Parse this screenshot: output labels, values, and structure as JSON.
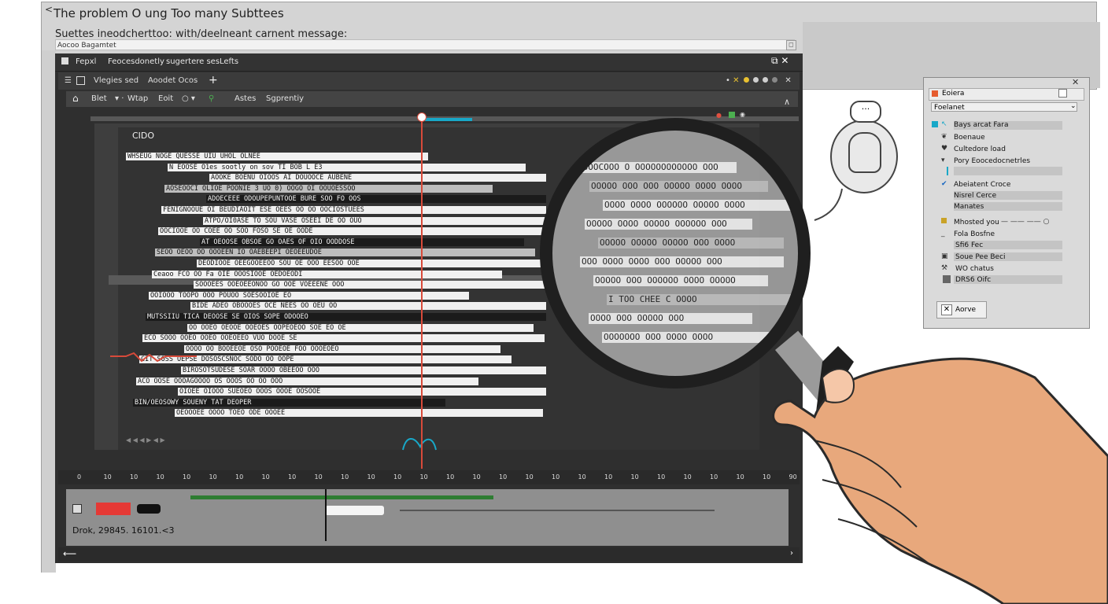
{
  "outer": {
    "back": "<",
    "title": "The problem O ung Too many Subttees",
    "subtitle": "Suettes ineodcherttoo: with/deelneant carnent message:",
    "field_value": "Aocoo Bagamtet"
  },
  "menu": {
    "items": [
      "Fepxl",
      "Feocesdonetly",
      "sugertere ses",
      "Lefts"
    ]
  },
  "tabs": [
    "Vlegies sed",
    "Aoodet Ocos"
  ],
  "toolbar": {
    "items": [
      "Blet",
      "Wtap",
      "Eoit",
      "Astes",
      "Sgprentiy"
    ]
  },
  "canvas": {
    "label": "CIDO"
  },
  "subtitle_lines": [
    {
      "t": "WHSEUG NOGE QUESSE UIU UHOL OLNEE",
      "s": "w"
    },
    {
      "t": "N EOOSE O1es sootly on sov TI BOB L E3",
      "s": "w"
    },
    {
      "t": "AOOKE BOENU OIOOS AI DOUOOCE AUBENE",
      "s": "w"
    },
    {
      "t": "AOSEOOCI OLIOE POONIE 3 UO 0) OOGO OI OOUOESSOO",
      "s": "g"
    },
    {
      "t": "ADOECEEE ODOUPEPUNTOOE BURE SOO FO OOS",
      "s": "b"
    },
    {
      "t": "FENIGNOOUE OI BEUDIAOIT ESE OEES OO OO OOCIOSTUEES",
      "s": "w"
    },
    {
      "t": "ATPO/OI0ASE TO SOU VASE OSEEI DE OO OUO",
      "s": "w"
    },
    {
      "t": "OOCIOOE OO COEE OO SOO FOSO SE OE OODE",
      "s": "w"
    },
    {
      "t": "AT OEOOSE OBSOE GO OAES OF OIO OODDOSE",
      "s": "b"
    },
    {
      "t": "SEOO OEOO OO OOOEEN IO OAEBEEPI OEOEEUDOE",
      "s": "g"
    },
    {
      "t": "DEODIOOE OEEGOOEEOO SOU OE OOO EESOO OOE",
      "s": "w"
    },
    {
      "t": "Ceaoo FCO OO Fa OIE OOOSIOOE OEDOEODI",
      "s": "w"
    },
    {
      "t": "SOOOEES OOEOEEONOO GO OOE VOEEENE OOO",
      "s": "w"
    },
    {
      "t": "OOIOOO TOOPO OOO POUOO SOESOOIOE EO",
      "s": "w"
    },
    {
      "t": "BIDE ADEO OBOOOES OCE NEES OO OEU OO",
      "s": "w"
    },
    {
      "t": "MUTSSIIU TICA DEOOSE SE OIOS SOPE ODOOEO",
      "s": "b"
    },
    {
      "t": "OO OOEO OEOOE OOEOES OOPEOEOO SOE EO OE",
      "s": "w"
    },
    {
      "t": "ECO SOOO OOEO OOEO OOEOEEO VUO DOOE SE",
      "s": "w"
    },
    {
      "t": "OOOO OO BOOEEOE OSO POOEOE FOO OOOEOEO",
      "s": "w"
    },
    {
      "t": "CIT SOSS OEPSE DOSOSCSNOC SODO OO OOPE",
      "s": "w"
    },
    {
      "t": "BIROSOTSUDESE SOAR OOOO OBEEOO OOO",
      "s": "w"
    },
    {
      "t": "ACO OOSE OOOAGOOOO OS OOOS OO OO OOO",
      "s": "w"
    },
    {
      "t": "OIOEE OIOOO SUEOEO OOOS OOOE OOSOOE",
      "s": "w"
    },
    {
      "t": "BIN/OEOSOWY SOUENY TAT DEOPER",
      "s": "b"
    },
    {
      "t": "OEOOOEE OOOO TOEO ODE OOOEE",
      "s": "w"
    }
  ],
  "lens_lines": [
    "OOOOCOOO O OOOOOOOOOOOO OOO",
    "OOOOO OOO OOO OOOOO OOOO OOOO",
    "OOOO OOOO OOOOOO OOOOO OOOO",
    "OOOOO OOOO OOOOO OOOOOO OOO",
    "OOOOO OOOOO OOOOO OOO OOOO",
    "OOO OOOO OOOO OOO OOOOO OOO",
    "OOOOO OOO OOOOOO OOOO OOOOO",
    "I TOO CHEE C OOOO",
    "OOOO OOO OOOOO OOO",
    "OOOOOOO OOO OOOO OOOO"
  ],
  "ruler_ticks": [
    "0",
    "10",
    "10",
    "10",
    "10",
    "10",
    "10",
    "10",
    "10",
    "10",
    "10",
    "10",
    "10",
    "10",
    "10",
    "10",
    "10",
    "10",
    "10",
    "10",
    "10",
    "10",
    "10",
    "10",
    "10",
    "10",
    "10",
    "90"
  ],
  "timeline": {
    "timecode": "Drok, 29845. 16101.<3"
  },
  "right_panel": {
    "header": "Eoiera",
    "dropdown": "Foelanet",
    "items": [
      "Bays arcat Fara",
      "Boenaue",
      "Cultedore load",
      "Pory Eoocedocnetrles",
      "",
      "Abeiatent Croce",
      "Nisrel Cerce",
      "Manates",
      "",
      "Mhosted you",
      "Fola Bosfne",
      "Sfi6 Fec",
      "Soue Pee Beci",
      "WO chatus",
      "DRS6 Oifc"
    ],
    "slider_label": "— —— —— ○",
    "button": "Aorve"
  },
  "colors": {
    "playhead": "#d84a3a",
    "accent_cyan": "#18a8c8",
    "track_green": "#2e7d32",
    "track_red": "#e53935",
    "skin": "#e8a87c"
  }
}
